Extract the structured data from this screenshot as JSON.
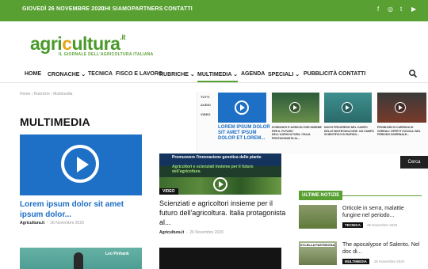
{
  "topbar": {
    "date": "GIOVEDÌ 26 NOVEMBRE 2020",
    "links": [
      "CHI SIAMO",
      "PARTNERS",
      "CONTATTI"
    ],
    "social": [
      "f",
      "◎",
      "t",
      "▶"
    ]
  },
  "logo": {
    "part1": "agri",
    "part2": "c",
    "part3": "ultura",
    "suffix": ".it",
    "tagline": "IL GIORNALE DELL'AGRICOLTURA ITALIANA"
  },
  "nav": {
    "items": [
      "HOME",
      "CRONACHE ⌄",
      "TECNICA",
      "FISCO E LAVORO",
      "RUBRICHE ⌄",
      "MULTIMEDIA ⌄",
      "AGENDA",
      "SPECIALI ⌄",
      "PUBBLICITÀ",
      "CONTATTI"
    ]
  },
  "breadcrumb": [
    "Home",
    "›",
    "Rubriche",
    "›",
    "Multimedia"
  ],
  "page_title": "MULTIMEDIA",
  "main_article": {
    "title": "Lorem ipsum dolor sit amet ipsum dolor...",
    "author": "Agricultura.it",
    "date": "26 Novembre 2020"
  },
  "center_article": {
    "thumb_caption": "Promuovere l'innovazione genetica delle piante",
    "thumb_caption2": "Agricoltori e scienziati insieme per il futuro dell'agricoltura",
    "tag": "VIDEO",
    "title": "Scienziati e agricoltori insieme per il futuro dell'agricoltura. Italia protagonista al...",
    "author": "Agricultura.it",
    "date": "26 Novembre 2020"
  },
  "overlay": {
    "subnav": [
      "TUTTI",
      "AUDIO",
      "VIDEO"
    ],
    "main_title": "LOREM IPSUM DOLOR SIT AMET IPSUM DOLOR ET LOREM...",
    "items": [
      "SCIENZIATI E AGRICOLTORI INSIEME PER IL FUTURO DELL'AGRICOLTURA. ITALIA PROTAGONISTA AL...",
      "NUOVI PROGRESSI NEL CAMPO DELLE BIOTECNOLOGIE: UN CAMPO SCIENTIFICO IN RAPIDO...",
      "PROBLEMI DI CARENZA DI CEREALI: EFFETTI SOCIALI NEL PERIODO INVERNALE...",
      "PROVE DI CAMPO E EFFETTI DEGLI PESTICIDI: NEL PERIODO INVERNALE NUOVA ETICHETTA..."
    ],
    "search_label": "Cerca"
  },
  "sidebar": {
    "heading": "ULTIME NOTIZIE",
    "items": [
      {
        "title": "Orticole in serra, malattie fungine nel periodo...",
        "tag": "TECNICA",
        "date": "26 Novembre 2020",
        "thumb_text": ""
      },
      {
        "title": "The apocalypse of Salento. Nel doc di...",
        "tag": "MULTIMEDIA",
        "date": "26 Novembre 2020",
        "thumb_text": "XYLELLA FASTIDIOSA"
      }
    ]
  },
  "bottom": {
    "left_label": "Leo Pinhank"
  },
  "colors": {
    "green": "#58a032",
    "blue": "#1e6fc6",
    "orange": "#e9a31a"
  }
}
